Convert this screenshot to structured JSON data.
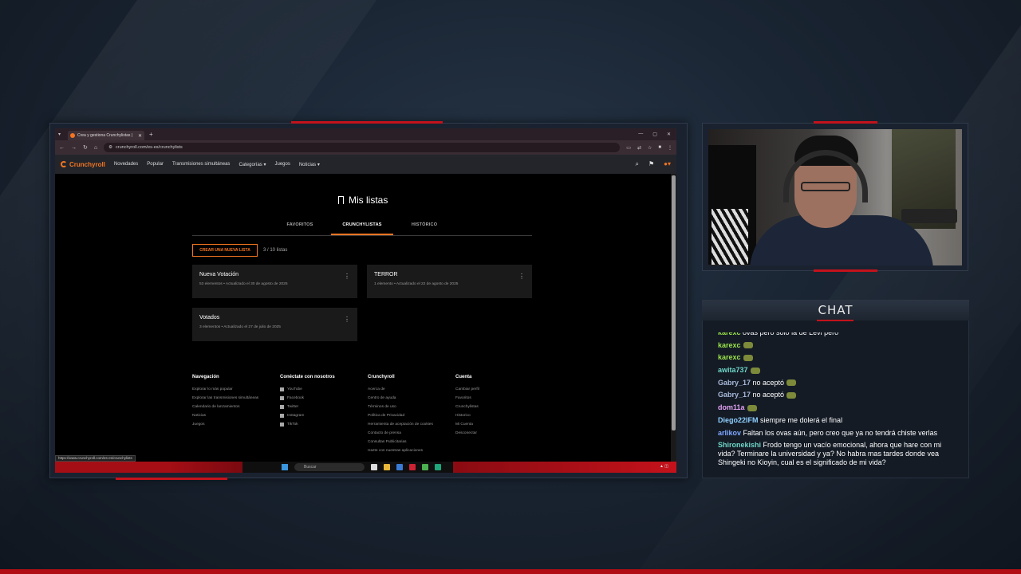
{
  "colors": {
    "accent": "#f47521",
    "stream_red": "#c4121b",
    "green_user": "#9be34a",
    "blue_user": "#7da7ff",
    "teal_user": "#6fd6c8"
  },
  "browser": {
    "tab_title": "Crea y gestiona Crunchylistas |",
    "new_tab_icon": "plus-icon",
    "url": "crunchyroll.com/es-es/crunchylists",
    "status_url": "https://www.crunchyroll.com/es-es/crunchylists"
  },
  "crunchyroll": {
    "logo": "Crunchyroll",
    "nav": [
      "Novedades",
      "Popular",
      "Transmisiones simultáneas",
      "Categorías",
      "Juegos",
      "Noticias"
    ],
    "page_title": "Mis listas",
    "tabs": [
      "FAVORITOS",
      "CRUNCHYLISTAS",
      "HISTÓRICO"
    ],
    "active_tab": "CRUNCHYLISTAS",
    "create_button": "CREAR UNA NUEVA LISTA",
    "list_count": "3 / 10 listas",
    "lists": [
      {
        "name": "Nueva Votación",
        "meta": "53 elementos • Actualizado el 30 de agosto de 2025"
      },
      {
        "name": "TERROR",
        "meta": "1 elemento • Actualizado el 22 de agosto de 2025"
      },
      {
        "name": "Votados",
        "meta": "3 elementos • Actualizado el 27 de julio de 2025"
      }
    ],
    "footer": {
      "navegacion": {
        "title": "Navegación",
        "links": [
          "Explorar lo más popular",
          "Explorar las transmisiones simultáneas",
          "Calendario de lanzamientos",
          "Noticias",
          "Juegos"
        ]
      },
      "social": {
        "title": "Conéctate con nosotros",
        "links": [
          "YouTube",
          "Facebook",
          "Twitter",
          "Instagram",
          "TikTok"
        ]
      },
      "crunchyroll": {
        "title": "Crunchyroll",
        "links": [
          "Acerca de",
          "Centro de ayuda",
          "Términos de uso",
          "Política de Privacidad",
          "Herramienta de aceptación de cookies",
          "Contacto de prensa",
          "Consultas Publicitarias",
          "Hazte con nuestras aplicaciones"
        ]
      },
      "cuenta": {
        "title": "Cuenta",
        "links": [
          "Cambiar perfil",
          "Favoritos",
          "Crunchylistas",
          "Historico",
          "Mi Cuenta",
          "Desconectar"
        ]
      }
    }
  },
  "taskbar": {
    "search_placeholder": "Buscar"
  },
  "chat": {
    "title": "CHAT",
    "messages": [
      {
        "user": "karexc",
        "text": "ovas pero solo la de Levi pero",
        "color": "#9be34a",
        "emote": false
      },
      {
        "user": "karexc",
        "text": "",
        "color": "#9be34a",
        "emote": true
      },
      {
        "user": "karexc",
        "text": "",
        "color": "#9be34a",
        "emote": true
      },
      {
        "user": "awita737",
        "text": "",
        "color": "#6fd6c8",
        "emote": true
      },
      {
        "user": "Gabry_17",
        "text": "no aceptó",
        "color": "#a7b8d8",
        "emote": true
      },
      {
        "user": "Gabry_17",
        "text": "no aceptó",
        "color": "#a7b8d8",
        "emote": true
      },
      {
        "user": "dom11a",
        "text": "",
        "color": "#e0a0f0",
        "emote": true
      },
      {
        "user": "Diego22IFM",
        "text": "siempre me dolerá el final",
        "color": "#8fd0ff",
        "emote": false
      },
      {
        "user": "arlikov",
        "text": "Faltan los ovas aún, pero creo que ya no tendrá chiste verlas",
        "color": "#7da7ff",
        "emote": false
      },
      {
        "user": "Shironekishi",
        "text": "Frodo tengo un vacío emocional, ahora que hare con mi vida? Terminare la universidad y ya? No habra mas tardes donde vea Shingeki no Kioyin, cual es el significado de mi vida?",
        "color": "#6fd6c8",
        "emote": false
      }
    ]
  }
}
